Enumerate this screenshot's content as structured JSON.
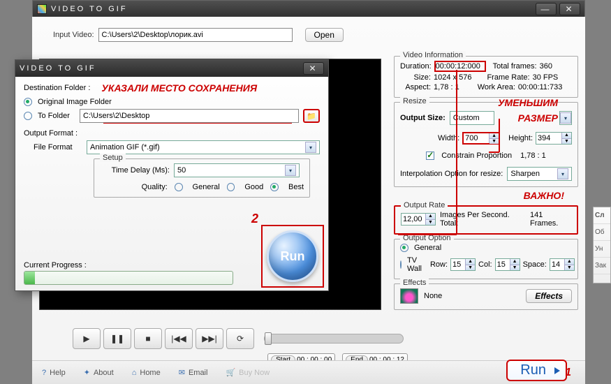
{
  "app_title": "VIDEO TO GIF",
  "main": {
    "input_video_label": "Input Video:",
    "input_video_value": "C:\\Users\\2\\Desktop\\лорик.avi",
    "open_btn": "Open"
  },
  "video_info": {
    "legend": "Video Information",
    "duration_label": "Duration:",
    "duration_value": "00:00:12:000",
    "total_frames_label": "Total frames:",
    "total_frames_value": "360",
    "size_label": "Size:",
    "size_value": "1024 x 576",
    "frame_rate_label": "Frame Rate:",
    "frame_rate_value": "30 FPS",
    "aspect_label": "Aspect:",
    "aspect_value": "1,78 : 1",
    "work_area_label": "Work Area:",
    "work_area_value": "00:00:11:733"
  },
  "resize": {
    "legend": "Resize",
    "output_size_label": "Output Size:",
    "output_size_value": "Custom",
    "width_label": "Width:",
    "width_value": "700",
    "height_label": "Height:",
    "height_value": "394",
    "constrain_label": "Constrain Proportion",
    "constrain_ratio": "1,78 : 1",
    "interp_label": "Interpolation Option for resize:",
    "interp_value": "Sharpen"
  },
  "output_rate": {
    "legend": "Output Rate",
    "value": "12,00",
    "note1": "Images Per Second. Total:",
    "note2": "141 Frames."
  },
  "output_option": {
    "legend": "Output Option",
    "general": "General",
    "tvwall": "TV Wall",
    "row_label": "Row:",
    "row_value": "15",
    "col_label": "Col:",
    "col_value": "15",
    "space_label": "Space:",
    "space_value": "14"
  },
  "effects": {
    "legend": "Effects",
    "value": "None",
    "button": "Effects"
  },
  "player": {
    "start_label": "Start",
    "start_value": "00 : 00 : 00",
    "end_label": "End",
    "end_value": "00 : 00 : 12"
  },
  "footer": {
    "help": "Help",
    "about": "About",
    "home": "Home",
    "email": "Email",
    "buy": "Buy Now",
    "run": "Run"
  },
  "annotations": {
    "save_loc": "УКАЗАЛИ МЕСТО СОХРАНЕНИЯ",
    "reduce_size_1": "УМЕНЬШИМ",
    "reduce_size_2": "РАЗМЕР",
    "important": "ВАЖНО!",
    "marker_1": "1",
    "marker_2": "2"
  },
  "dialog": {
    "title": "VIDEO TO GIF",
    "dest_folder_label": "Destination Folder :",
    "orig_folder": "Original Image Folder",
    "to_folder": "To Folder",
    "to_folder_value": "C:\\Users\\2\\Desktop",
    "output_format_label": "Output Format :",
    "file_format_label": "File Format",
    "file_format_value": "Animation GIF (*.gif)",
    "setup_legend": "Setup",
    "time_delay_label": "Time Delay (Ms):",
    "time_delay_value": "50",
    "quality_label": "Quality:",
    "q_general": "General",
    "q_good": "Good",
    "q_best": "Best",
    "progress_label": "Current Progress :",
    "run": "Run"
  },
  "sidepanel": {
    "h": "Сл",
    "r1": "Об",
    "r2": "Ун",
    "r3": "Зак"
  }
}
